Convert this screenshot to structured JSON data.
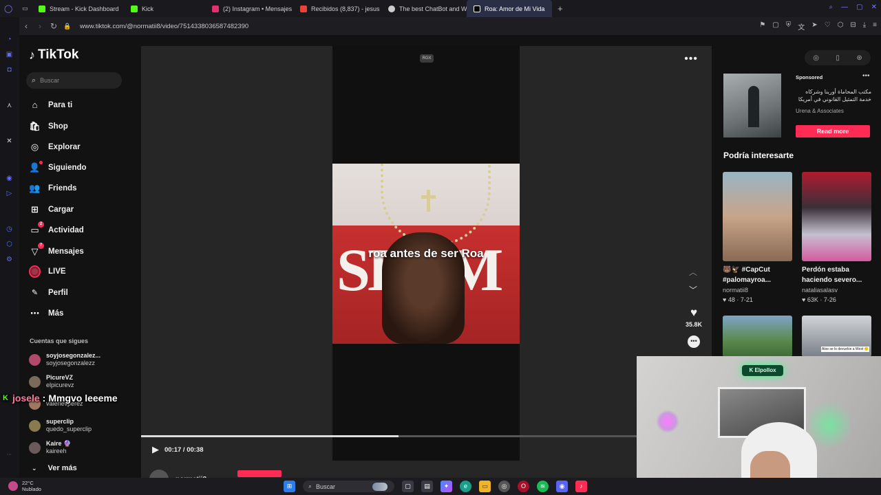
{
  "browser": {
    "tabs": [
      {
        "label": "Stream - Kick Dashboard",
        "color": "#53fc18"
      },
      {
        "label": "Kick",
        "color": "#53fc18"
      },
      {
        "label": "(2) Instagram • Mensajes",
        "color": "#e1306c"
      },
      {
        "label": "Recibidos (8,837) - jesus",
        "color": "#ea4335"
      },
      {
        "label": "The best ChatBot and W",
        "color": "#cccccc"
      },
      {
        "label": "Roa: Amor de Mi Vida",
        "color": "#ffffff",
        "active": true
      }
    ],
    "url": "www.tiktok.com/@normatii8/video/7514338036587482390"
  },
  "tiktok": {
    "logo": "TikTok",
    "search_placeholder": "Buscar",
    "nav": [
      {
        "label": "Para ti",
        "icon": "home-icon"
      },
      {
        "label": "Shop",
        "icon": "shop-icon"
      },
      {
        "label": "Explorar",
        "icon": "compass-icon"
      },
      {
        "label": "Siguiendo",
        "icon": "following-icon"
      },
      {
        "label": "Friends",
        "icon": "friends-icon"
      },
      {
        "label": "Cargar",
        "icon": "upload-icon"
      },
      {
        "label": "Actividad",
        "icon": "activity-icon",
        "badge": "2"
      },
      {
        "label": "Mensajes",
        "icon": "messages-icon",
        "badge": "7"
      },
      {
        "label": "LIVE",
        "icon": "live-icon"
      },
      {
        "label": "Perfil",
        "icon": "profile-icon"
      },
      {
        "label": "Más",
        "icon": "more-icon"
      }
    ],
    "following_title": "Cuentas que sigues",
    "following": [
      {
        "name": "soyjosegonzalez...",
        "handle": "soyjosegonzalezz",
        "color": "#b0496a"
      },
      {
        "name": "PicureVZ",
        "handle": "elpicurevz",
        "color": "#7a6a5a"
      },
      {
        "name": "",
        "handle": "valerievperez",
        "color": "#a07860"
      },
      {
        "name": "superclip",
        "handle": "quedo_superclip",
        "color": "#8a7a50"
      },
      {
        "name": "Kaire 🔮",
        "handle": "kaireeh",
        "color": "#6a5a5a"
      }
    ],
    "see_more": "Ver más"
  },
  "video": {
    "caption": "roa antes de ser Roa",
    "watermark": "RGX",
    "likes": "35.8K",
    "progress": 0.52,
    "time": "00:17 / 00:38",
    "author": "normatii8"
  },
  "sidebar_right": {
    "sponsored": "Sponsored",
    "ad_text": "مكتب المحاماة أورينا وشركاه خدمة التمثيل القانوني في أمريكا",
    "ad_brand": "Urena & Associates",
    "cta": "Read more",
    "section_title": "Podría interesarte",
    "cards": [
      {
        "title": "🐻🦅 #CapCut",
        "title2": "#palomayroa...",
        "author": "normatii8",
        "stats": "♥ 48 · 7-21"
      },
      {
        "title": "Perdón estaba",
        "title2": "haciendo severo...",
        "author": "nataliasalasv",
        "stats": "♥ 63K · 7-26"
      }
    ],
    "card3_text": "Aloe se lo devuelve a West 🙂"
  },
  "stream": {
    "chat_user": "josele",
    "chat_msg": "Mmgvo leeeme",
    "cam_sign": "Elpollox"
  },
  "taskbar": {
    "temp": "22°C",
    "cond": "Nublado",
    "search": "Buscar"
  }
}
